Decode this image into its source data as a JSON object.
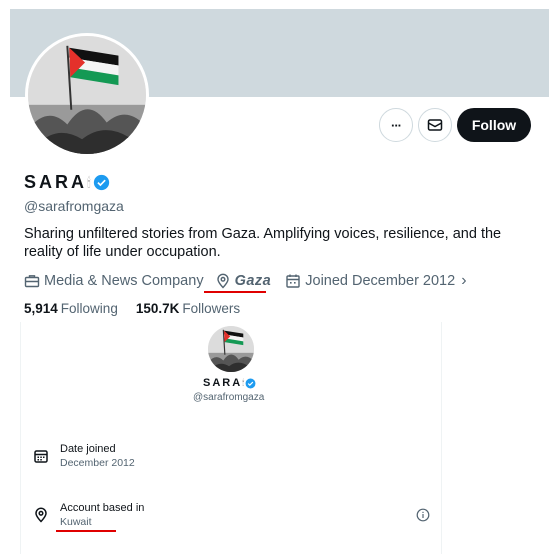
{
  "profile": {
    "display_name": "SARA",
    "name_emoji": "🕯",
    "handle": "@sarafromgaza",
    "bio": "Sharing unfiltered stories from Gaza. Amplifying voices, resilience, and the reality of life under occupation.",
    "category": "Media & News Company",
    "location": "Gaza",
    "joined": "Joined December 2012",
    "following_count": "5,914",
    "following_label": "Following",
    "followers_count": "150.7K",
    "followers_label": "Followers"
  },
  "actions": {
    "more_label": "···",
    "follow_label": "Follow"
  },
  "about_card": {
    "name": "SARA",
    "handle": "@sarafromgaza",
    "date_joined_label": "Date joined",
    "date_joined_value": "December 2012",
    "account_based_label": "Account based in",
    "account_based_value": "Kuwait"
  },
  "colors": {
    "accent_verified": "#1d9bf0",
    "highlight_underline": "#e00000",
    "banner": "#cfd9de"
  },
  "icons": [
    "more-icon",
    "message-icon",
    "verified-badge-icon",
    "briefcase-icon",
    "location-pin-icon",
    "calendar-icon",
    "chevron-right-icon",
    "info-icon"
  ]
}
